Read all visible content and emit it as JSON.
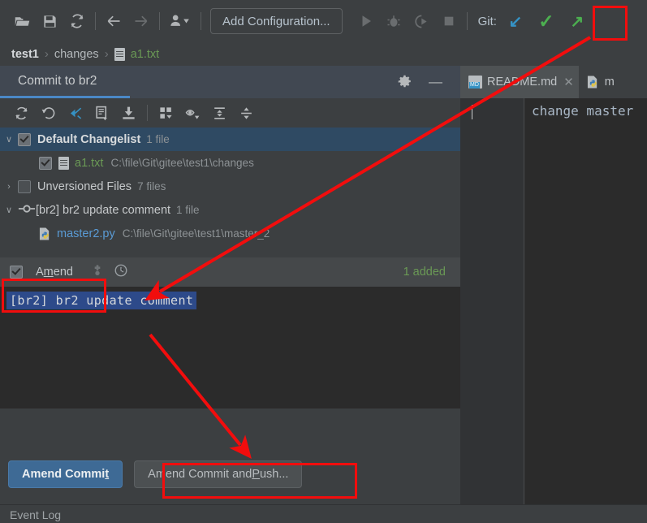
{
  "toolbar": {
    "icons": [
      "open-folder-icon",
      "save-icon",
      "sync-icon",
      "back-arrow-icon",
      "forward-arrow-icon",
      "users-icon",
      "chevron-down-icon"
    ],
    "run_config_label": "Add Configuration...",
    "run_icon": "run-icon",
    "debug_icon": "debug-icon",
    "coverage_icon": "run-with-coverage-icon",
    "stop_icon": "stop-icon",
    "git_label": "Git:",
    "git_update_icon": "update-project-arrow-icon",
    "git_commit_icon": "commit-checkmark-icon",
    "git_push_icon": "push-arrow-icon"
  },
  "breadcrumb": {
    "project": "test1",
    "folder": "changes",
    "file": "a1.txt",
    "separator": "›"
  },
  "commit_panel": {
    "title": "Commit to br2",
    "gear_icon": "gear-icon",
    "minimize_icon": "minimize-icon",
    "toolbar_icons": [
      "refresh-changes-icon",
      "rollback-icon",
      "collapse-to-icon",
      "show-diff-icon",
      "get-from-vcs-icon",
      "group-by-icon",
      "preview-eye-icon",
      "expand-all-icon",
      "collapse-all-icon"
    ],
    "tree": [
      {
        "label": "Default Changelist",
        "count": "1 file",
        "chevron": "∨",
        "checked": true,
        "selected": true,
        "level": 0,
        "icon": "none"
      },
      {
        "label": "a1.txt",
        "path": "C:\\file\\Git\\gitee\\test1\\changes",
        "checked": true,
        "selected": false,
        "level": 1,
        "icon": "text-file-icon",
        "color": "green"
      },
      {
        "label": "Unversioned Files",
        "count": "7 files",
        "chevron": "›",
        "checked": false,
        "selected": false,
        "level": 0,
        "icon": "none"
      },
      {
        "label": "[br2] br2 update comment",
        "count": "1 file",
        "chevron": "∨",
        "selected": false,
        "level": 0,
        "icon": "commit-node-icon"
      },
      {
        "label": "master2.py",
        "path": "C:\\file\\Git\\gitee\\test1\\master_2",
        "selected": false,
        "level": 1,
        "icon": "python-file-icon",
        "color": "blue"
      }
    ],
    "amend": {
      "label_pre": "A",
      "label_mnemonic": "m",
      "label_post": "end",
      "checked": true,
      "settings_icon": "amend-settings-icon",
      "history_icon": "clock-history-icon",
      "status": "1 added"
    },
    "message": {
      "value": "[br2] br2 update comment",
      "selected": true
    },
    "buttons": {
      "primary_pre": "Amend Commi",
      "primary_mnemonic": "t",
      "primary_post": "",
      "secondary_pre": "Amend Commit and ",
      "secondary_mnemonic": "P",
      "secondary_post": "ush..."
    }
  },
  "editor": {
    "tabs": [
      {
        "label": "README.md",
        "icon": "markdown-file-icon",
        "active": true,
        "close_icon": "close-icon"
      },
      {
        "label": "m",
        "icon": "python-file-icon",
        "active": false
      }
    ],
    "code_line": "change master"
  },
  "status_bar": {
    "event_log": "Event Log"
  },
  "annotations": {
    "color": "#f20d0d",
    "boxes": [
      "git-commit-icon-highlight",
      "amend-checkbox-highlight",
      "amend-commit-and-push-highlight"
    ],
    "arrows": [
      "arrow-to-clock-history-icon",
      "arrow-to-amend-and-push-button"
    ]
  }
}
